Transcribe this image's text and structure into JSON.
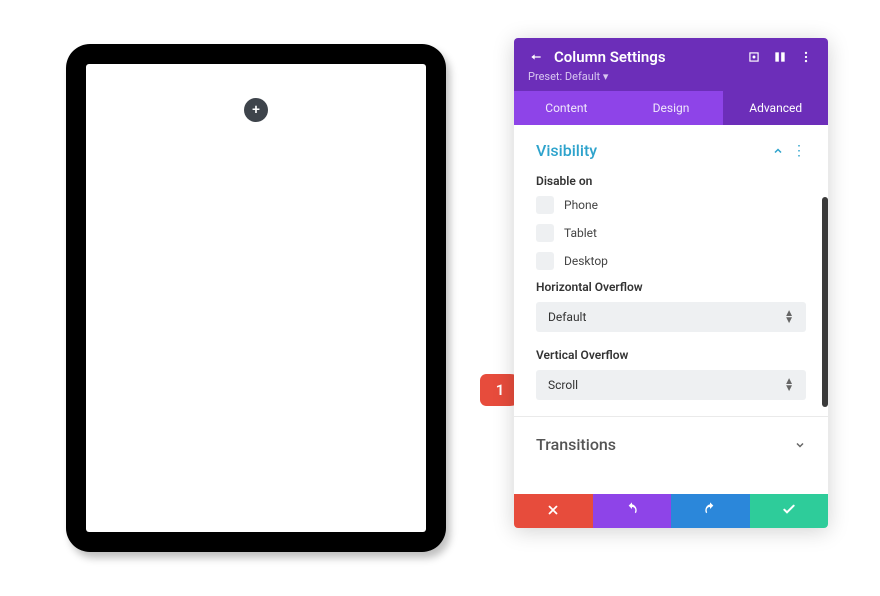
{
  "annotation": {
    "number": "1"
  },
  "panel": {
    "title": "Column Settings",
    "preset_label": "Preset: Default",
    "tabs": {
      "content": "Content",
      "design": "Design",
      "advanced": "Advanced"
    }
  },
  "visibility": {
    "title": "Visibility",
    "disable_on_label": "Disable on",
    "options": {
      "phone": "Phone",
      "tablet": "Tablet",
      "desktop": "Desktop"
    },
    "horizontal_overflow_label": "Horizontal Overflow",
    "horizontal_overflow_value": "Default",
    "vertical_overflow_label": "Vertical Overflow",
    "vertical_overflow_value": "Scroll"
  },
  "transitions": {
    "title": "Transitions"
  }
}
